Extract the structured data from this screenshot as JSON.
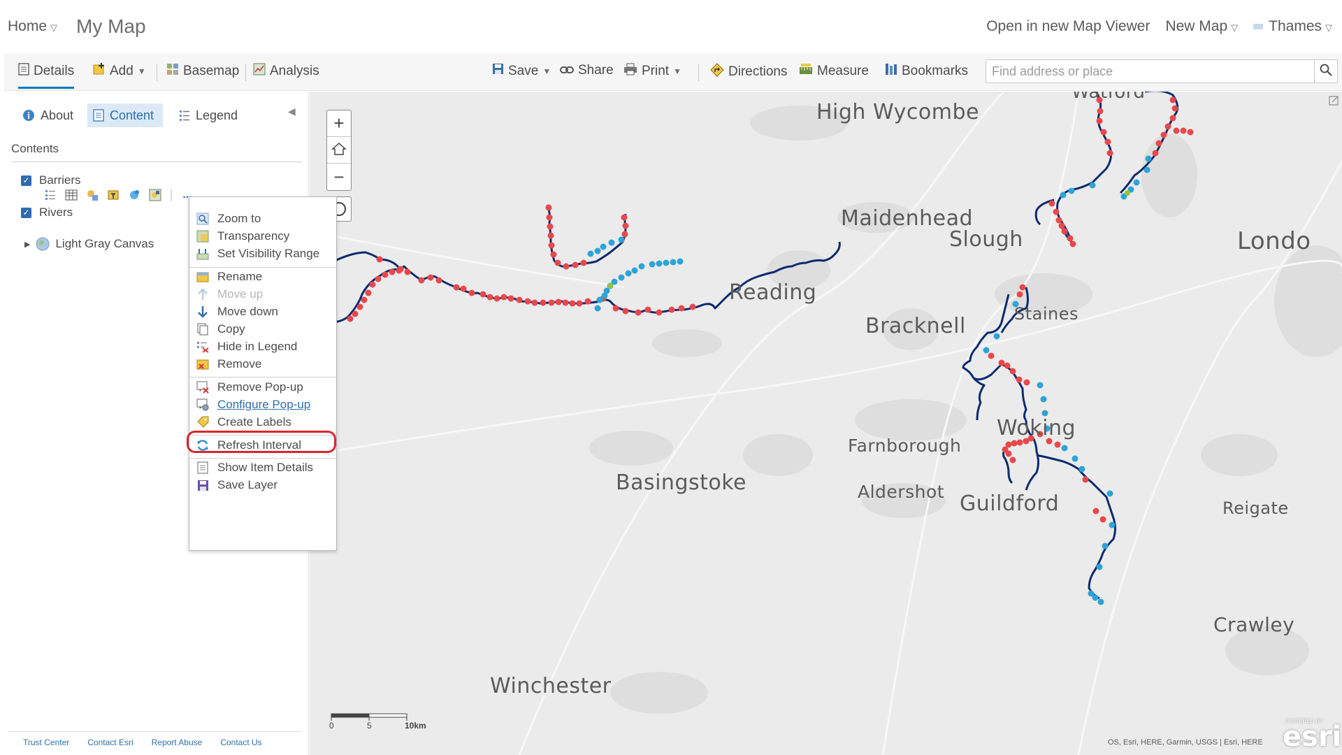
{
  "header": {
    "home_label": "Home",
    "map_title": "My Map",
    "open_new_viewer": "Open in new Map Viewer",
    "new_map": "New Map",
    "user": "Thames"
  },
  "toolbar": {
    "details": "Details",
    "add": "Add",
    "basemap": "Basemap",
    "analysis": "Analysis",
    "save": "Save",
    "share": "Share",
    "print": "Print",
    "directions": "Directions",
    "measure": "Measure",
    "bookmarks": "Bookmarks",
    "search_placeholder": "Find address or place"
  },
  "panel": {
    "tabs": {
      "about": "About",
      "content": "Content",
      "legend": "Legend"
    },
    "contents_heading": "Contents",
    "layers": {
      "barriers": "Barriers",
      "rivers": "Rivers",
      "basemap": "Light Gray Canvas"
    },
    "more": "...",
    "footer": [
      "Trust Center",
      "Contact Esri",
      "Report Abuse",
      "Contact Us"
    ]
  },
  "menu": {
    "items": [
      "Zoom to",
      "Transparency",
      "Set Visibility Range",
      "Rename",
      "Move up",
      "Move down",
      "Copy",
      "Hide in Legend",
      "Remove",
      "Remove Pop-up",
      "Configure Pop-up",
      "Create Labels",
      "Refresh Interval",
      "Show Item Details",
      "Save Layer"
    ]
  },
  "map": {
    "cities": {
      "high_wycombe": "High Wycombe",
      "watford": "Watford",
      "maidenhead": "Maidenhead",
      "slough": "Slough",
      "london": "Londo",
      "reading": "Reading",
      "bracknell": "Bracknell",
      "staines": "Staines",
      "woking": "Woking",
      "farnborough": "Farnborough",
      "basingstoke": "Basingstoke",
      "aldershot": "Aldershot",
      "guildford": "Guildford",
      "reigate": "Reigate",
      "crawley": "Crawley",
      "winchester": "Winchester"
    },
    "scale": {
      "t0": "0",
      "t5": "5",
      "t10": "10km"
    },
    "attribution": "OS, Esri, HERE, Garmin, USGS | Esri, HERE",
    "logo": "esri",
    "logo_powered": "POWERED BY"
  },
  "colors": {
    "accent": "#0079c1",
    "river": "#0d2b6e",
    "barrier_red": "#e8484c",
    "barrier_blue": "#2ea3d7",
    "highlight": "#d8262e"
  }
}
